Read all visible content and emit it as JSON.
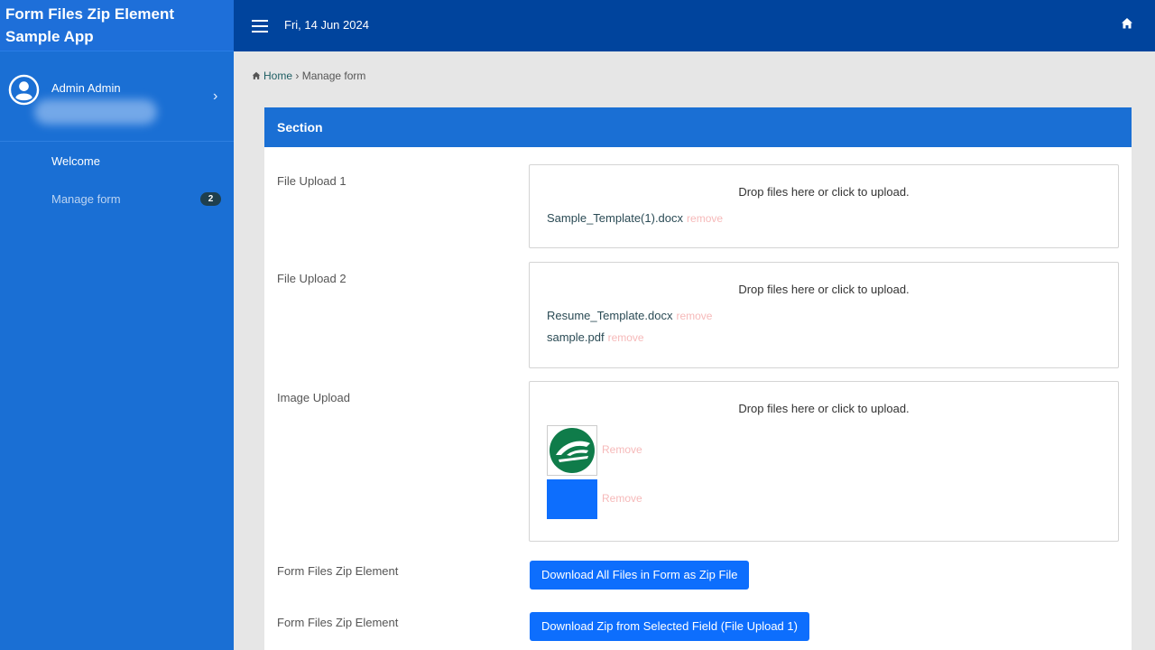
{
  "app": {
    "title": "Form Files Zip Element Sample App"
  },
  "user": {
    "name": "Admin Admin"
  },
  "nav": {
    "items": [
      {
        "label": "Welcome"
      },
      {
        "label": "Manage form",
        "badge": "2"
      }
    ]
  },
  "topbar": {
    "date": "Fri, 14 Jun 2024"
  },
  "breadcrumb": {
    "home": "Home",
    "separator": "›",
    "current": "Manage form"
  },
  "section": {
    "title": "Section"
  },
  "fields": {
    "upload1": {
      "label": "File Upload 1",
      "dropzone_message": "Drop files here or click to upload.",
      "files": [
        {
          "name": "Sample_Template(1).docx",
          "remove": "remove"
        }
      ]
    },
    "upload2": {
      "label": "File Upload 2",
      "dropzone_message": "Drop files here or click to upload.",
      "files": [
        {
          "name": "Resume_Template.docx",
          "remove": "remove"
        },
        {
          "name": "sample.pdf",
          "remove": "remove"
        }
      ]
    },
    "image": {
      "label": "Image Upload",
      "dropzone_message": "Drop files here or click to upload.",
      "images": [
        {
          "kind": "green-logo",
          "remove": "Remove"
        },
        {
          "kind": "blue-square",
          "remove": "Remove"
        }
      ]
    },
    "zip1": {
      "label": "Form Files Zip Element",
      "button": "Download All Files in Form as Zip File"
    },
    "zip2": {
      "label": "Form Files Zip Element",
      "button": "Download Zip from Selected Field (File Upload 1)"
    }
  },
  "colors": {
    "sidebar": "#1a6fd4",
    "topbar": "#00449d",
    "section_header": "#1a6fd4",
    "button": "#0d6efd",
    "remove_link": "#f6b9b9",
    "logo_green": "#0f7c4a"
  }
}
